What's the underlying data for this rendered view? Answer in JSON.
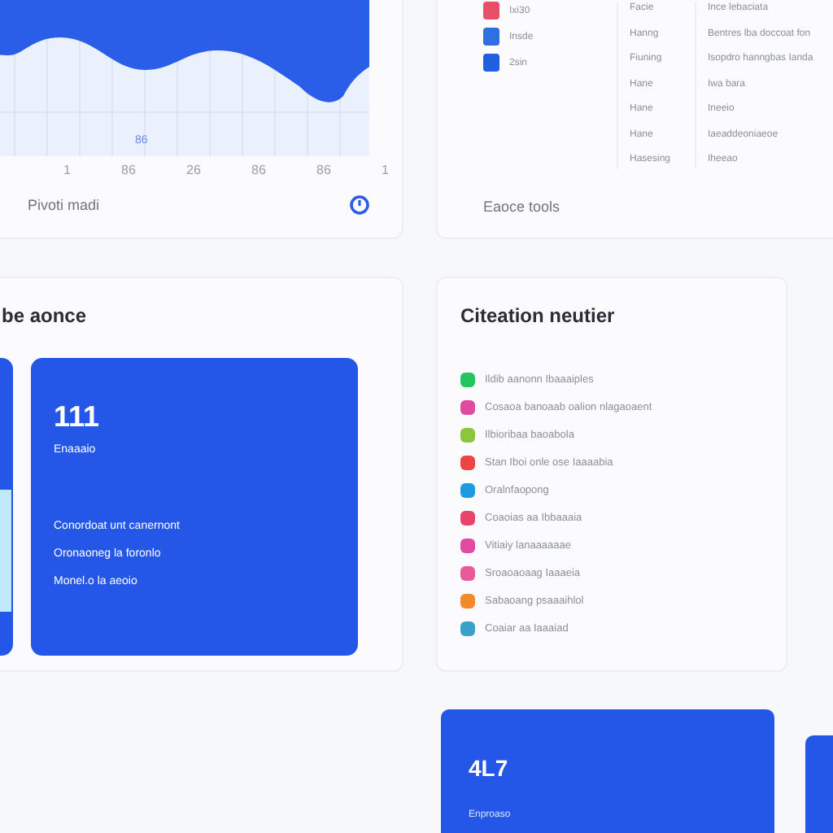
{
  "trend_card": {
    "chart_label": "86",
    "x_ticks": [
      "1",
      "86",
      "26",
      "86",
      "86",
      "1"
    ],
    "footer": "Pivoti madi"
  },
  "tools_card": {
    "apps": [
      {
        "label": "Ixi30",
        "color": "#e8506a"
      },
      {
        "label": "Insde",
        "color": "#2f6fe0"
      },
      {
        "label": "2sin",
        "color": "#1f5fe0"
      }
    ],
    "rows": [
      {
        "name": "Facie",
        "detail": "Ince lebaciata"
      },
      {
        "name": "Hanng",
        "detail": "Bentres lba doccoat fon"
      },
      {
        "name": "Fiuning",
        "detail": "Isopdro hanngbas Ianda"
      },
      {
        "name": "Hane",
        "detail": "Iwa bara"
      },
      {
        "name": "Hane",
        "detail": "Ineeio"
      },
      {
        "name": "Hane",
        "detail": "Iaeaddeoniaeoe"
      },
      {
        "name": "Hasesing",
        "detail": "Iheeao"
      }
    ],
    "footer": "Eaoce tools"
  },
  "summary_card": {
    "title": "be aonce",
    "tile": {
      "value": "111",
      "caption": "Enaaaio",
      "lines": [
        "Conordoat unt canernont",
        "Oronaoneg la foronlo",
        "Monel.o la aeoio"
      ]
    }
  },
  "list_card": {
    "title": "Citeation neutier",
    "items": [
      {
        "label": "Ildib aanonn Ibaaaiples",
        "color": "#22c55e"
      },
      {
        "label": "Cosaoa banoaab oalion nlagaoaent",
        "color": "#e04aa0"
      },
      {
        "label": "Ilbioribaa baoabola",
        "color": "#8cc63f"
      },
      {
        "label": "Stan Iboi onle ose Iaaaabia",
        "color": "#ef4444"
      },
      {
        "label": "Oralnfaopong",
        "color": "#1e9be0"
      },
      {
        "label": "Coaoias aa Ibbaaaia",
        "color": "#e8456a"
      },
      {
        "label": "Vitiaiy lanaaaaaae",
        "color": "#e04aa0"
      },
      {
        "label": "Sroaoaoaag Iaaaeia",
        "color": "#e85a9a"
      },
      {
        "label": "Sabaoang psaaaihlol",
        "color": "#f28a2a"
      },
      {
        "label": "Coaiar aa Iaaaiad",
        "color": "#3aa0c8"
      }
    ]
  },
  "stat_card": {
    "value": "4L7",
    "caption": "Enproaso"
  }
}
